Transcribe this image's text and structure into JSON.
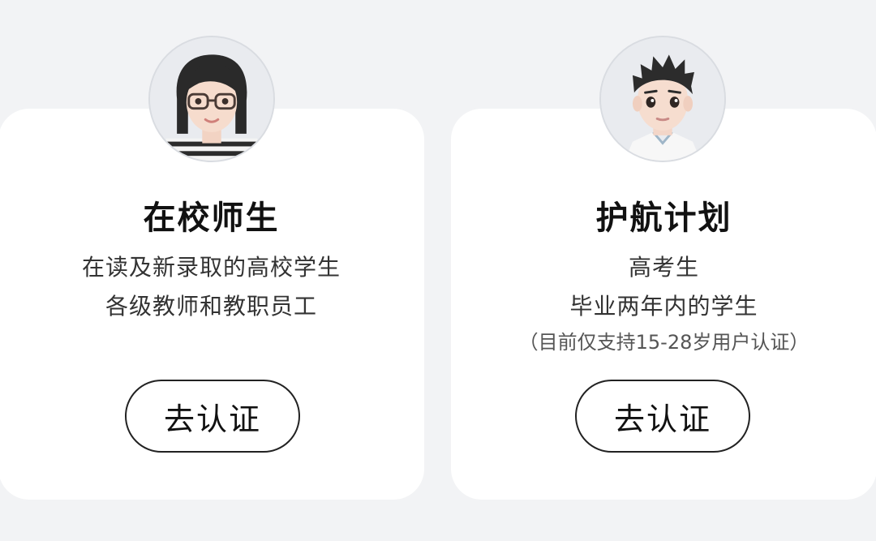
{
  "cards": [
    {
      "title": "在校师生",
      "desc_lines": [
        "在读及新录取的高校学生",
        "各级教师和教职员工"
      ],
      "note": "",
      "button_label": "去认证",
      "avatar": "female-avatar-with-glasses"
    },
    {
      "title": "护航计划",
      "desc_lines": [
        "高考生",
        "毕业两年内的学生"
      ],
      "note": "（目前仅支持15-28岁用户认证）",
      "button_label": "去认证",
      "avatar": "male-avatar-short-hair"
    }
  ],
  "colors": {
    "background": "#f2f3f5",
    "card": "#ffffff",
    "text": "#1a1a1a",
    "button_border": "#222222"
  }
}
